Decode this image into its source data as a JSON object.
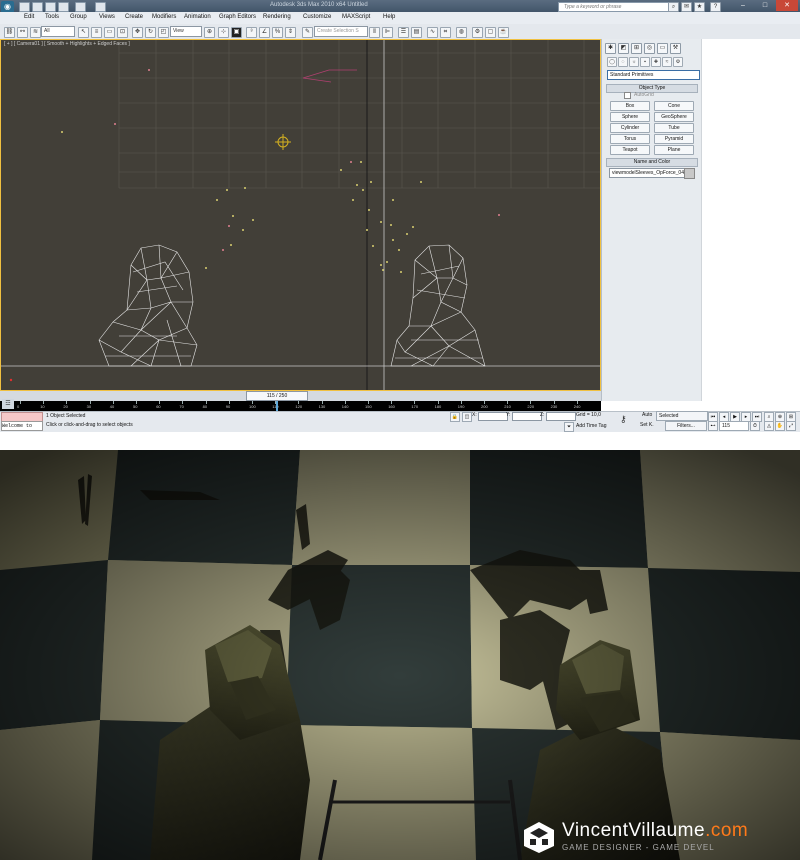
{
  "window": {
    "title": "Autodesk 3ds Max 2010 x64 Untitled",
    "search_placeholder": "Type a keyword or phrase"
  },
  "menu": [
    "Edit",
    "Tools",
    "Group",
    "Views",
    "Create",
    "Modifiers",
    "Animation",
    "Graph Editors",
    "Rendering",
    "Customize",
    "MAXScript",
    "Help"
  ],
  "toolbar": {
    "selection_filter": "All",
    "reference_coord": "View",
    "named_selection_placeholder": "Create Selection S"
  },
  "viewport": {
    "label": "[ + ] [ Camera01 ] [ Smooth + Highlights + Edged Faces ]"
  },
  "command_panel": {
    "category": "Standard Primitives",
    "object_type_header": "Object Type",
    "autogrid_label": "AutoGrid",
    "buttons": [
      "Box",
      "Cone",
      "Sphere",
      "GeoSphere",
      "Cylinder",
      "Tube",
      "Torus",
      "Pyramid",
      "Teapot",
      "Plane"
    ],
    "name_color_header": "Name and Color",
    "object_name": "viewmodelSleeves_OpForce_04"
  },
  "timeline": {
    "frame_display": "115 / 250",
    "ruler_labels": [
      "0",
      "10",
      "20",
      "30",
      "40",
      "50",
      "60",
      "70",
      "80",
      "90",
      "100",
      "110",
      "120",
      "130",
      "140",
      "150",
      "160",
      "170",
      "180",
      "190",
      "200",
      "210",
      "220",
      "230",
      "240"
    ]
  },
  "status": {
    "welcome": "Welcome to",
    "selection": "1 Object Selected",
    "prompt": "Click or click-and-drag to select objects",
    "x_label": "X:",
    "y_label": "Y:",
    "z_label": "Z:",
    "grid": "Grid = 10,0",
    "add_time_tag": "Add Time Tag",
    "auto": "Auto",
    "set_key": "Set K.",
    "key_filter": "Selected",
    "filters": "Filters...",
    "current_frame": "115"
  },
  "watermark": {
    "name": "VincentVillaume",
    "domain": ".com",
    "tagline": "GAME DESIGNER - GAME DEVEL"
  },
  "colors": {
    "viewport_bg": "#423f38",
    "accent": "#ff7a1a"
  }
}
